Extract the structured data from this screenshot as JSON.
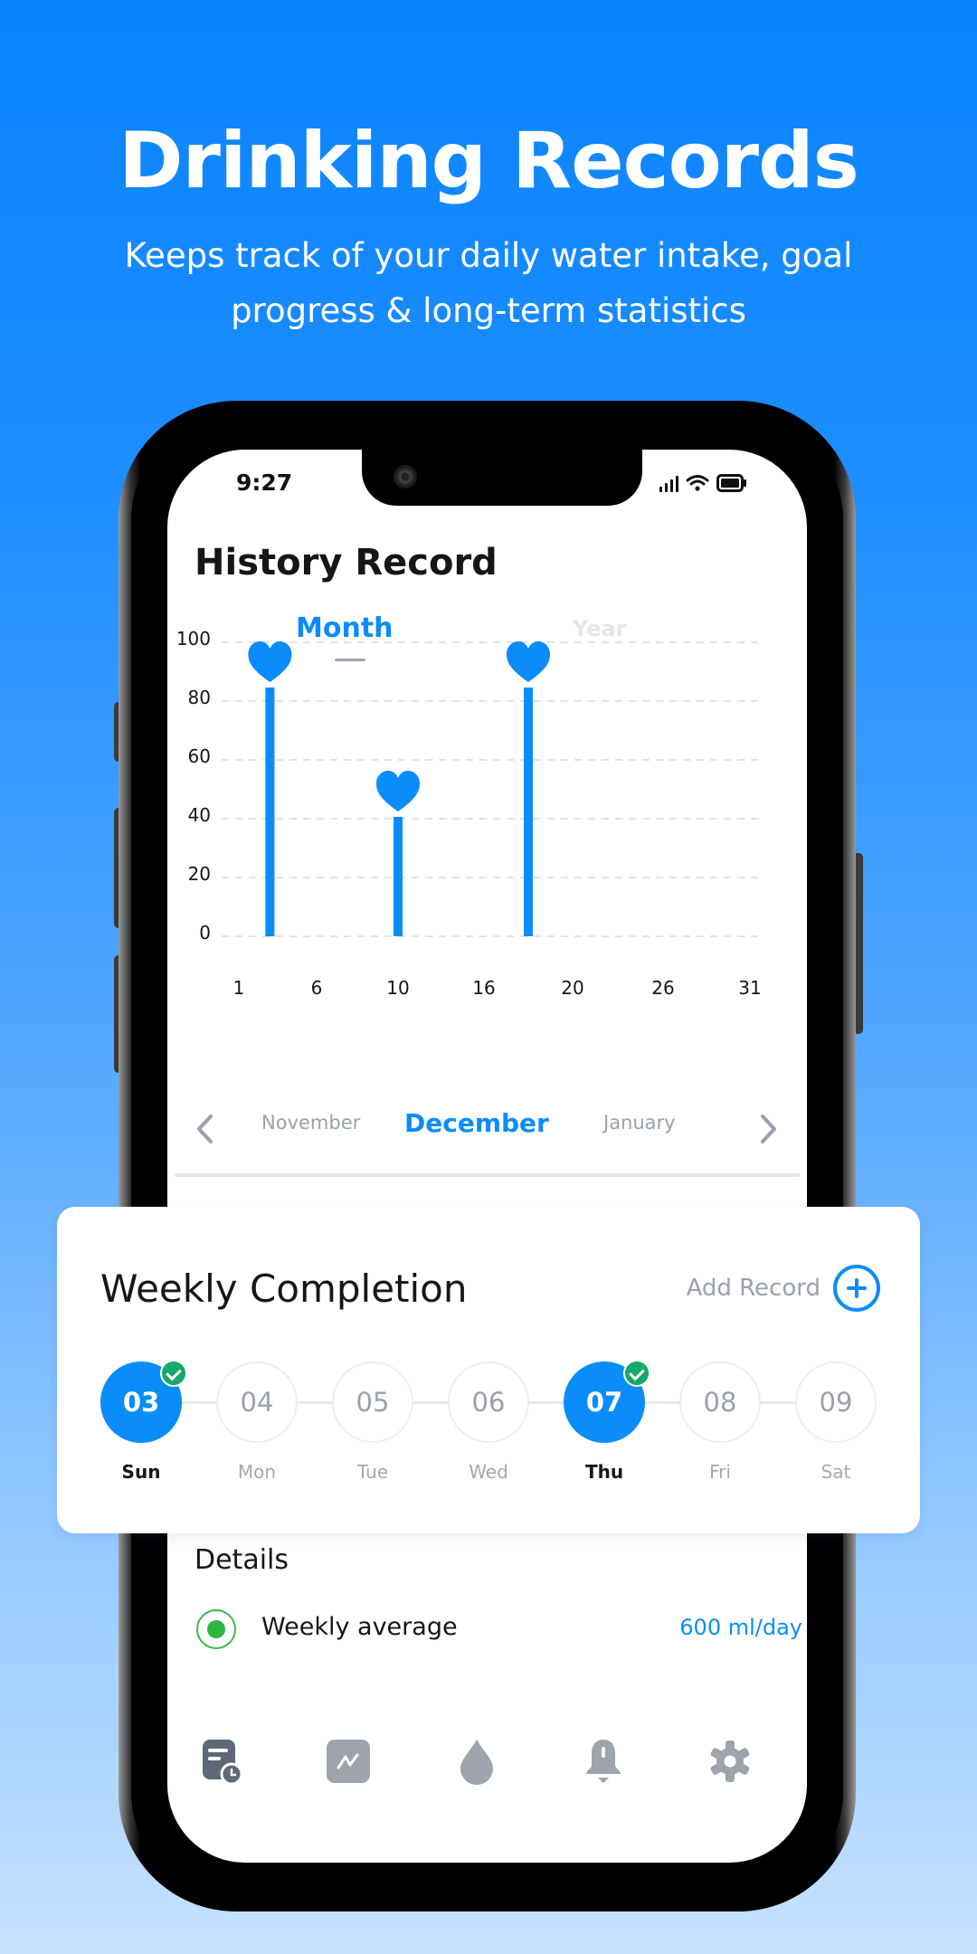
{
  "hero": {
    "title": "Drinking Records",
    "subtitle": "Keeps track of your daily water intake, goal progress & long-term statistics"
  },
  "status_bar": {
    "time": "9:27"
  },
  "screen": {
    "title": "History Record",
    "tabs": [
      {
        "label": "Month",
        "active": true
      },
      {
        "label": "Year",
        "active": false
      }
    ],
    "month_nav": {
      "prev": "November",
      "current": "December",
      "next": "January"
    },
    "details": {
      "title": "Details",
      "rows": [
        {
          "label": "Weekly average",
          "value": "600 ml/day"
        }
      ]
    },
    "tabbar": [
      {
        "icon": "history-record-icon",
        "active": true
      },
      {
        "icon": "statistics-chart-icon",
        "active": false
      },
      {
        "icon": "water-drop-icon",
        "active": false
      },
      {
        "icon": "bell-reminder-icon",
        "active": false
      },
      {
        "icon": "settings-gear-icon",
        "active": false
      }
    ]
  },
  "weekly": {
    "title": "Weekly Completion",
    "add_label": "Add Record",
    "days": [
      {
        "num": "03",
        "name": "Sun",
        "done": true
      },
      {
        "num": "04",
        "name": "Mon",
        "done": false
      },
      {
        "num": "05",
        "name": "Tue",
        "done": false
      },
      {
        "num": "06",
        "name": "Wed",
        "done": false
      },
      {
        "num": "07",
        "name": "Thu",
        "done": true
      },
      {
        "num": "08",
        "name": "Fri",
        "done": false
      },
      {
        "num": "09",
        "name": "Sat",
        "done": false
      }
    ]
  },
  "colors": {
    "accent": "#0a8dfb",
    "success": "#17a86b",
    "muted": "#9ba0ab",
    "grid": "#dfe3ec"
  },
  "chart_data": {
    "type": "bar",
    "title": "",
    "xlabel": "",
    "ylabel": "",
    "marker": "heart",
    "x_ticks": [
      "1",
      "6",
      "10",
      "16",
      "20",
      "26",
      "31"
    ],
    "y_ticks": [
      "0",
      "20",
      "40",
      "60",
      "80",
      "100"
    ],
    "ylim": [
      0,
      100
    ],
    "grid": true,
    "points": [
      {
        "day": 3,
        "value": 100
      },
      {
        "day": 10,
        "value": 56
      },
      {
        "day": 18,
        "value": 100
      }
    ]
  }
}
